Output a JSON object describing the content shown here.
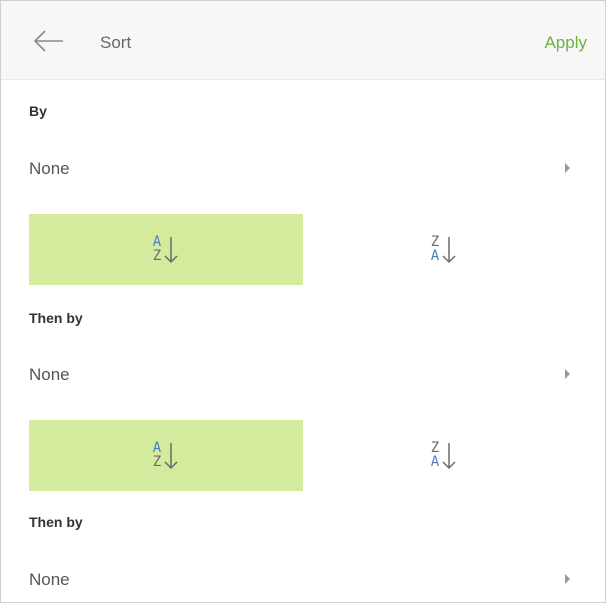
{
  "header": {
    "title": "Sort",
    "apply_label": "Apply"
  },
  "sections": [
    {
      "label": "By",
      "value": "None"
    },
    {
      "label": "Then by",
      "value": "None"
    },
    {
      "label": "Then by",
      "value": "None"
    }
  ],
  "sort_toggles": {
    "ascending": {
      "top": "A",
      "bottom": "Z",
      "selected": true
    },
    "descending": {
      "top": "Z",
      "bottom": "A",
      "selected": false
    }
  },
  "icons": {
    "back": "arrow-left-icon",
    "chevron": "chevron-right-icon",
    "ascending": "sort-a-z-icon",
    "descending": "sort-z-a-icon"
  },
  "colors": {
    "accent": "#6bb33a",
    "toggle_active_bg": "#d4ea9c",
    "icon_blue": "#4a7fc1",
    "icon_gray": "#6b6b6b"
  }
}
